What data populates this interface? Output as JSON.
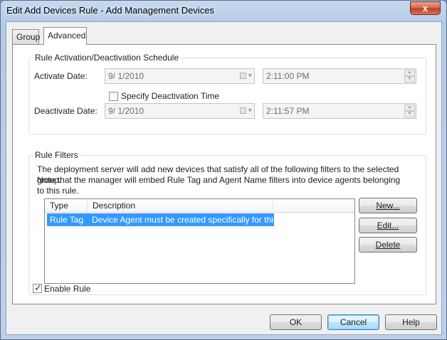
{
  "window": {
    "title": "Edit Add Devices Rule - Add Management Devices",
    "close_label": "x"
  },
  "tabs": [
    {
      "label": "Group",
      "selected": false
    },
    {
      "label": "Advanced",
      "selected": true
    }
  ],
  "schedule": {
    "legend": "Rule Activation/Deactivation Schedule",
    "activate_label": "Activate Date:",
    "activate_date": "9/  1/2010",
    "activate_time": "2:11:00 PM",
    "specify_deactivation_label": "Specify Deactivation Time",
    "specify_deactivation_checked": false,
    "deactivate_label": "Deactivate Date:",
    "deactivate_date": "9/  1/2010",
    "deactivate_time": "2:11:57 PM"
  },
  "filters": {
    "legend": "Rule Filters",
    "description_line1": "The deployment server will add new devices that satisfy all of the following filters to the selected group.",
    "description_line2": "Note that the manager will embed Rule Tag and Agent Name filters into device agents belonging to this rule.",
    "columns": [
      "Type",
      "Description"
    ],
    "rows": [
      {
        "type": "Rule Tag",
        "description": "Device Agent must be created specifically for this...",
        "selected": true
      }
    ],
    "new_label": "New...",
    "edit_label": "Edit...",
    "delete_label": "Delete"
  },
  "enable_rule": {
    "label": "Enable Rule",
    "checked": true
  },
  "footer": {
    "ok_label": "OK",
    "cancel_label": "Cancel",
    "help_label": "Help"
  },
  "colors": {
    "selection": "#3399ff",
    "close_button": "#c2401d"
  }
}
